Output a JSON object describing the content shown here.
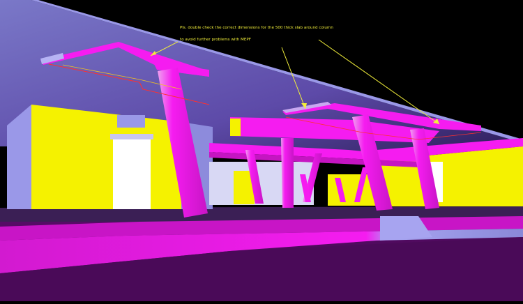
{
  "markup": {
    "comment_line_1": "Pls. double check the correct dimensions for the 500 thick slab around column",
    "comment_line_2": "to avoid further problems with MEPF"
  },
  "colors": {
    "background": "#000000",
    "column_magenta": "#f51cf0",
    "wall_yellow": "#f5f200",
    "lavender": "#9a98e8",
    "floor_purple": "#4d0a5c",
    "annotation_yellow": "#f2ef3a",
    "slab_outline_red": "#ff3030"
  }
}
